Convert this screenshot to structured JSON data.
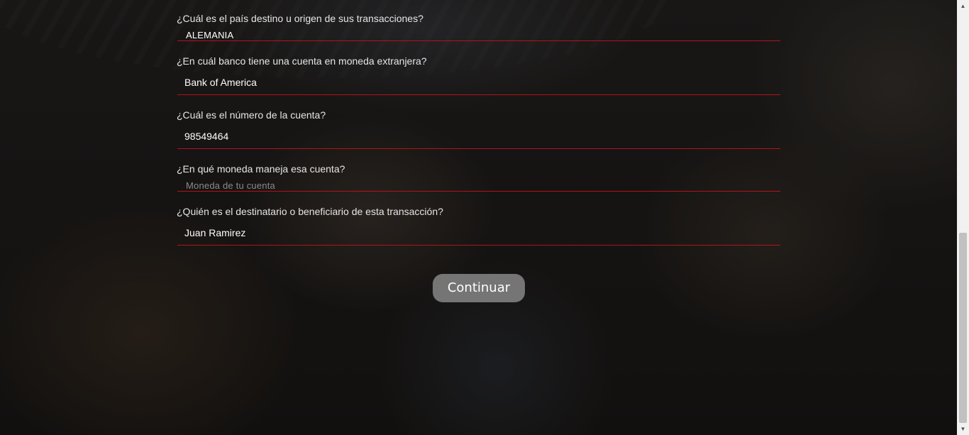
{
  "form": {
    "fields": [
      {
        "label": "¿Cuál es el país destino u origen de sus transacciones?",
        "value": "ALEMANIA",
        "placeholder": ""
      },
      {
        "label": "¿En cuál banco tiene una cuenta en moneda extranjera?",
        "value": "Bank of America",
        "placeholder": ""
      },
      {
        "label": "¿Cuál es el número de la cuenta?",
        "value": "98549464",
        "placeholder": ""
      },
      {
        "label": "¿En qué moneda maneja esa cuenta?",
        "value": "",
        "placeholder": "Moneda de tu cuenta"
      },
      {
        "label": "¿Quién es el destinatario o beneficiario de esta transacción?",
        "value": "Juan Ramirez",
        "placeholder": ""
      }
    ],
    "submit_label": "Continuar"
  },
  "colors": {
    "underline": "#b3121b",
    "button": "#757575"
  },
  "icons": {
    "scroll_up": "triangle-up-icon",
    "scroll_down": "triangle-down-icon"
  }
}
